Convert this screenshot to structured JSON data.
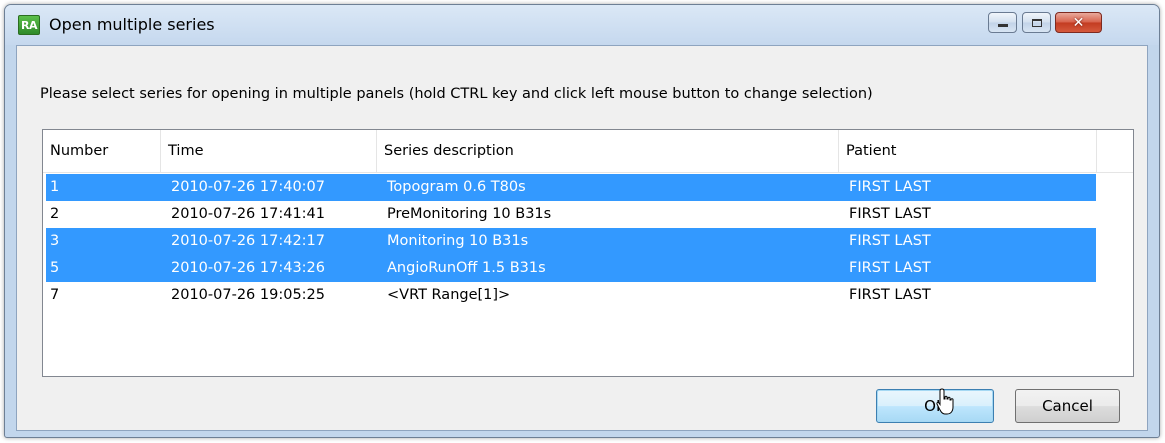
{
  "window": {
    "icon_text": "RA",
    "title": "Open multiple series",
    "controls": {
      "minimize_icon": "minimize-icon",
      "maximize_icon": "maximize-icon",
      "close_icon": "close-icon",
      "close_glyph": "✕"
    }
  },
  "instructions": "Please select series for opening in multiple panels (hold CTRL key and click left mouse button to change selection)",
  "table": {
    "headers": [
      "Number",
      "Time",
      "Series description",
      "Patient"
    ],
    "rows": [
      {
        "number": "1",
        "time": "2010-07-26 17:40:07",
        "description": "Topogram  0.6  T80s",
        "patient": "FIRST LAST",
        "selected": true
      },
      {
        "number": "2",
        "time": "2010-07-26 17:41:41",
        "description": "PreMonitoring  10  B31s",
        "patient": "FIRST LAST",
        "selected": false
      },
      {
        "number": "3",
        "time": "2010-07-26 17:42:17",
        "description": "Monitoring  10  B31s",
        "patient": "FIRST LAST",
        "selected": true
      },
      {
        "number": "5",
        "time": "2010-07-26 17:43:26",
        "description": "AngioRunOff  1.5  B31s",
        "patient": "FIRST LAST",
        "selected": true
      },
      {
        "number": "7",
        "time": "2010-07-26 19:05:25",
        "description": "<VRT Range[1]>",
        "patient": "FIRST LAST",
        "selected": false
      }
    ]
  },
  "buttons": {
    "ok": "OK",
    "cancel": "Cancel"
  },
  "colors": {
    "selection": "#3399ff",
    "frame": "#c2d6ec",
    "close_button": "#c23b21"
  }
}
